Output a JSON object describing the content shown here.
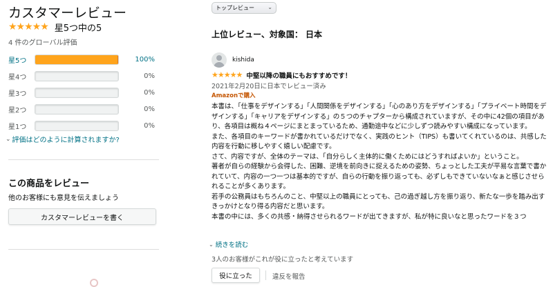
{
  "summary": {
    "title": "カスタマーレビュー",
    "stars": "★★★★★",
    "rating_text": "星5つ中の5",
    "rating_value": 5,
    "global_count_text": "4 件のグローバル評価",
    "histogram": [
      {
        "label": "星5つ",
        "percent": 100,
        "percent_text": "100%"
      },
      {
        "label": "星4つ",
        "percent": 0,
        "percent_text": "0%"
      },
      {
        "label": "星3つ",
        "percent": 0,
        "percent_text": "0%"
      },
      {
        "label": "星2つ",
        "percent": 0,
        "percent_text": "0%"
      },
      {
        "label": "星1つ",
        "percent": 0,
        "percent_text": "0%"
      }
    ],
    "how_calculated": "評価はどのように計算されますか?"
  },
  "write_review": {
    "heading": "この商品をレビュー",
    "subtext": "他のお客様にも意見を伝えましょう",
    "button_label": "カスタマーレビューを書く"
  },
  "reviews_panel": {
    "sort_selected": "トップレビュー",
    "heading": "上位レビュー、対象国： 日本"
  },
  "review": {
    "reviewer_name": "kishida",
    "stars": "★★★★★",
    "rating_value": 5,
    "title": "中堅以降の職員にもおすすめです！",
    "date": "2021年2月20日に日本でレビュー済み",
    "verified": "Amazonで購入",
    "body": [
      "本書は、「仕事をデザインする」「人間関係をデザインする」「心のあり方をデザインする」「プライベート時間をデザインする」「キャリアをデザインする」の５つのチャプターから構成されていますが、その中に42個の項目があり、各項目は概ね４ページにまとまっているため、通勤途中などに少しずつ読みやすい構成になっています。",
      "また、各項目のキーワードが書かれているだけでなく、実践のヒント（TIPS）も書いてくれているのは、共感した内容を行動に移しやすく嬉しい配慮です。",
      "",
      "さて、内容ですが、全体のテーマは、「自分らしく主体的に働くためにはどうすればよいか」ということ。",
      "著者が自らの経験から会得した、困難、逆境を前向きに捉えるための姿勢、ちょっとした工夫が平易な言葉で書かれていて、内容の一つ一つは基本的ですが、自らの行動を振り返っても、必ずしもできていないなぁと感じさせられることが多くあります。",
      "若手の公務員はもちろんのこと、中堅以上の職員にとっても、己の過ぎ越し方を振り返り、新たな一歩を踏み出すきっかけとなり得る内容だと思います。",
      "本書の中には、多くの共感・納得させられるワードが出てきますが、私が特に良いなと思ったワードを３つ"
    ],
    "read_more": "続きを読む",
    "helpful_text": "3人のお客様がこれが役に立ったと考えています",
    "helpful_button": "役に立った",
    "report_label": "違反を報告"
  },
  "colors": {
    "star": "#ffa41c",
    "link": "#007185",
    "verified": "#c45500",
    "bar_fill": "#ffa41c"
  }
}
